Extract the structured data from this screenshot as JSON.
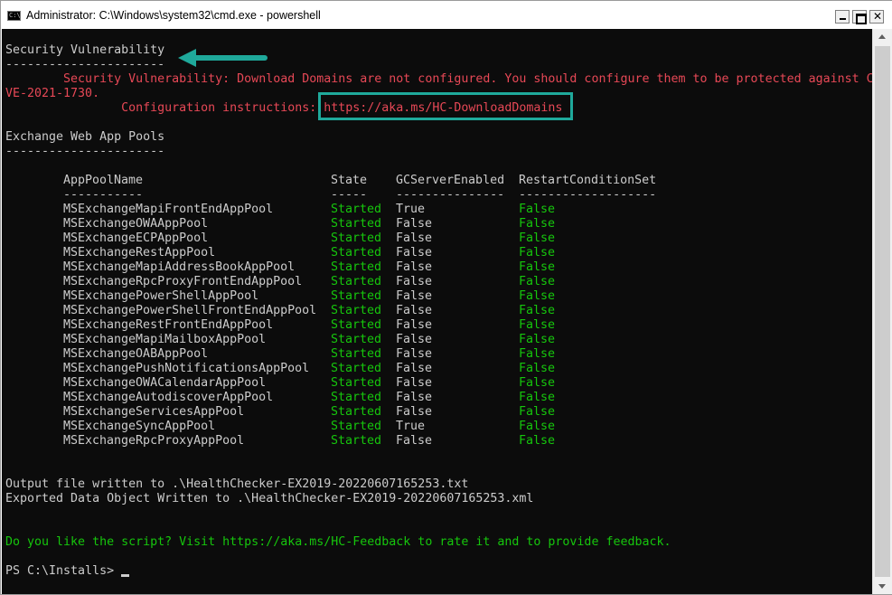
{
  "window": {
    "title": "Administrator: C:\\Windows\\system32\\cmd.exe - powershell",
    "icon_text": "C:\\",
    "controls": {
      "minimize": "minimize-icon",
      "maximize": "maximize-icon",
      "close": "✕"
    }
  },
  "colors": {
    "background": "#0c0c0c",
    "text": "#cccccc",
    "red": "#e74856",
    "green": "#16c60c",
    "annotation": "#1fa99b"
  },
  "console": {
    "section1_title": "Security Vulnerability",
    "section1_rule": "----------------------",
    "vuln_line1": "        Security Vulnerability: Download Domains are not configured. You should configure them to be protected against C",
    "vuln_line2": "VE-2021-1730.",
    "config_label": "                Configuration instructions: ",
    "config_url": "https://aka.ms/HC-DownloadDomains",
    "section2_title": "Exchange Web App Pools",
    "section2_rule": "----------------------",
    "table": {
      "headers": [
        "AppPoolName",
        "State",
        "GCServerEnabled",
        "RestartConditionSet"
      ],
      "rules": [
        "-----------",
        "-----",
        "---------------",
        "-------------------"
      ],
      "rows": [
        [
          "MSExchangeMapiFrontEndAppPool",
          "Started",
          "True",
          "False"
        ],
        [
          "MSExchangeOWAAppPool",
          "Started",
          "False",
          "False"
        ],
        [
          "MSExchangeECPAppPool",
          "Started",
          "False",
          "False"
        ],
        [
          "MSExchangeRestAppPool",
          "Started",
          "False",
          "False"
        ],
        [
          "MSExchangeMapiAddressBookAppPool",
          "Started",
          "False",
          "False"
        ],
        [
          "MSExchangeRpcProxyFrontEndAppPool",
          "Started",
          "False",
          "False"
        ],
        [
          "MSExchangePowerShellAppPool",
          "Started",
          "False",
          "False"
        ],
        [
          "MSExchangePowerShellFrontEndAppPool",
          "Started",
          "False",
          "False"
        ],
        [
          "MSExchangeRestFrontEndAppPool",
          "Started",
          "False",
          "False"
        ],
        [
          "MSExchangeMapiMailboxAppPool",
          "Started",
          "False",
          "False"
        ],
        [
          "MSExchangeOABAppPool",
          "Started",
          "False",
          "False"
        ],
        [
          "MSExchangePushNotificationsAppPool",
          "Started",
          "False",
          "False"
        ],
        [
          "MSExchangeOWACalendarAppPool",
          "Started",
          "False",
          "False"
        ],
        [
          "MSExchangeAutodiscoverAppPool",
          "Started",
          "False",
          "False"
        ],
        [
          "MSExchangeServicesAppPool",
          "Started",
          "False",
          "False"
        ],
        [
          "MSExchangeSyncAppPool",
          "Started",
          "True",
          "False"
        ],
        [
          "MSExchangeRpcProxyAppPool",
          "Started",
          "False",
          "False"
        ]
      ]
    },
    "output_line": "Output file written to .\\HealthChecker-EX2019-20220607165253.txt",
    "exported_line": "Exported Data Object Written to .\\HealthChecker-EX2019-20220607165253.xml",
    "feedback_line": "Do you like the script? Visit https://aka.ms/HC-Feedback to rate it and to provide feedback.",
    "prompt": "PS C:\\Installs> "
  }
}
